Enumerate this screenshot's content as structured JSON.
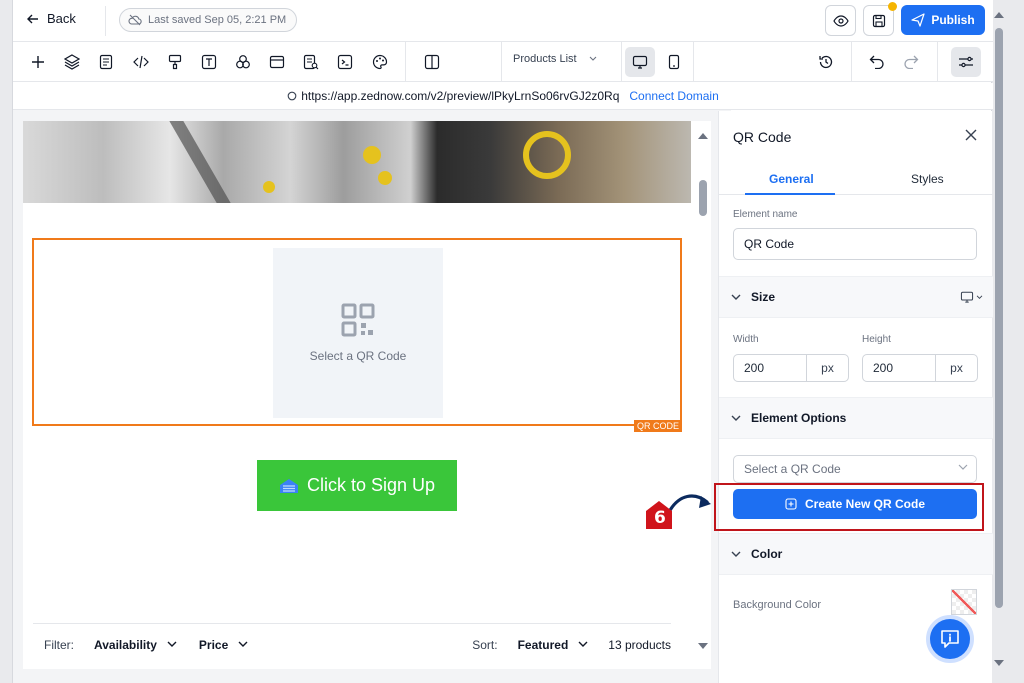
{
  "header": {
    "back_label": "Back",
    "saved_status": "Last saved Sep 05, 2:21 PM",
    "publish_label": "Publish"
  },
  "toolbar": {
    "tools": [
      "plus-icon",
      "layers-icon",
      "pages-icon",
      "code-icon",
      "paint-icon",
      "text-icon",
      "components-icon",
      "layout-icon",
      "form-icon",
      "terminal-icon",
      "palette-icon",
      "columns-icon"
    ],
    "page_select": "Products List"
  },
  "urlbar": {
    "url": "https://app.zednow.com/v2/preview/lPkyLrnSo06rvGJ2z0Rq",
    "connect_label": "Connect Domain"
  },
  "canvas": {
    "qr_placeholder": "Select a QR Code",
    "qr_tag": "QR CODE",
    "signup_label": "Click to Sign Up",
    "filter_label": "Filter:",
    "filter_options": [
      "Availability",
      "Price"
    ],
    "sort_label": "Sort:",
    "sort_value": "Featured",
    "product_count": "13 products"
  },
  "panel": {
    "title": "QR Code",
    "tabs": [
      "General",
      "Styles"
    ],
    "element_name_label": "Element name",
    "element_name_value": "QR Code",
    "size_header": "Size",
    "width_label": "Width",
    "width_value": "200",
    "width_unit": "px",
    "height_label": "Height",
    "height_value": "200",
    "height_unit": "px",
    "options_header": "Element Options",
    "select_placeholder": "Select a QR Code",
    "create_label": "Create New QR Code",
    "color_header": "Color",
    "bg_color_label": "Background Color"
  },
  "annotation": {
    "step_number": "6"
  },
  "colors": {
    "accent": "#1d6ff2",
    "selection": "#f07a1a",
    "signup": "#3ac63a",
    "highlight": "#c0151b"
  }
}
